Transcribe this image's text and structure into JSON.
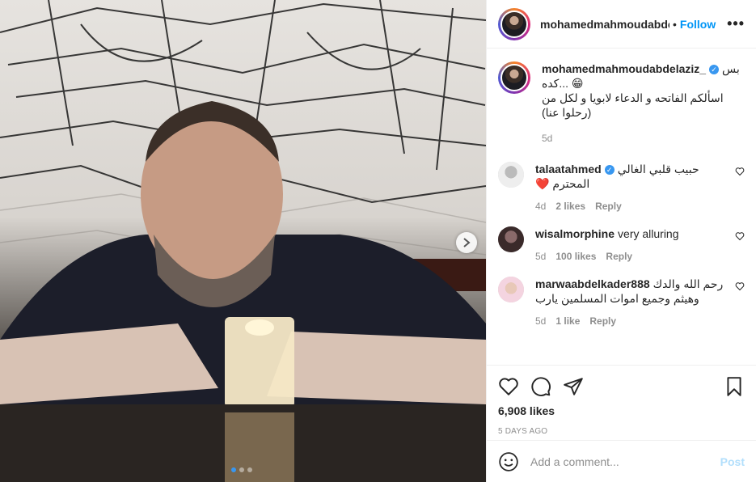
{
  "header": {
    "username": "mohamedmahmoudabde",
    "separator": "•",
    "follow_label": "Follow",
    "more_label": "•••"
  },
  "caption": {
    "username": "mohamedmahmoudabdelaziz_",
    "text": "بس كده... 😁\nاسألكم الفاتحه و الدعاء لابويا و لكل من رحلوا عنا)",
    "line1": "بس",
    "line2": "كده... 😁",
    "line3": "اسألكم الفاتحه و الدعاء لابويا و لكل من",
    "line4": "(رحلوا عنا)",
    "time": "5d"
  },
  "comments": [
    {
      "username": "talaatahmed",
      "verified": true,
      "text": "حبيب قلبي الغالي المحترم ❤️",
      "time": "4d",
      "likes": "2 likes",
      "reply": "Reply"
    },
    {
      "username": "wisalmorphine",
      "verified": false,
      "text": "very alluring",
      "time": "5d",
      "likes": "100 likes",
      "reply": "Reply"
    },
    {
      "username": "marwaabdelkader888",
      "verified": false,
      "text": "رحم الله والدك وهيثم وجميع اموات المسلمين يارب",
      "time": "5d",
      "likes": "1 like",
      "reply": "Reply"
    }
  ],
  "footer": {
    "likes": "6,908 likes",
    "posted": "5 DAYS AGO",
    "comment_placeholder": "Add a comment...",
    "post_label": "Post"
  },
  "carousel": {
    "slide_count": 3,
    "active_index": 0
  },
  "colors": {
    "accent": "#0095f6",
    "muted": "#8e8e8e",
    "verified": "#3897f0",
    "post_disabled": "#b2dffc"
  }
}
